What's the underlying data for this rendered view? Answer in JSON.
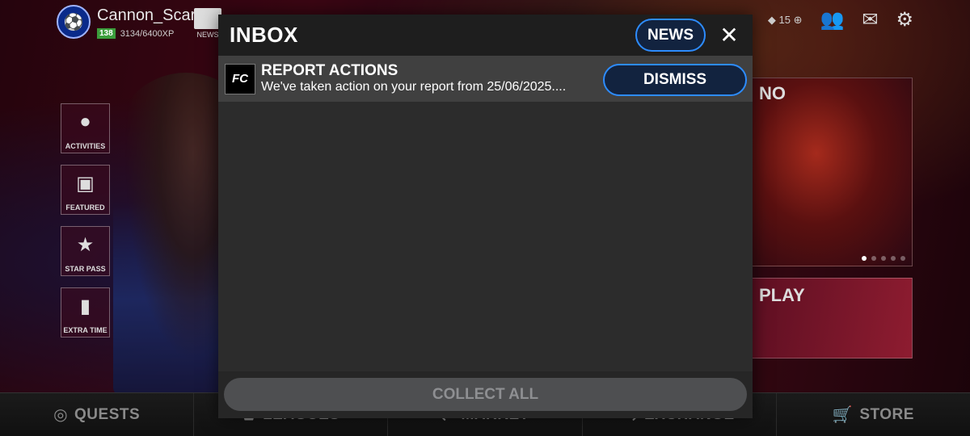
{
  "background": {
    "username": "Cannon_Scar",
    "level": "138",
    "xp": "3134/6400XP",
    "news_label": "NEWS",
    "coins": "15",
    "side_menu": [
      {
        "label": "ACTIVITIES",
        "icon": "ball-icon"
      },
      {
        "label": "FEATURED",
        "icon": "gift-icon"
      },
      {
        "label": "STAR PASS",
        "icon": "star-icon"
      },
      {
        "label": "EXTRA TIME",
        "icon": "card-icon"
      }
    ],
    "promo_title": "NO",
    "play_title": "PLAY",
    "bottom_nav": [
      {
        "label": "QUESTS",
        "icon": "target-icon"
      },
      {
        "label": "LEAGUES",
        "icon": "shield-icon"
      },
      {
        "label": "MARKET",
        "icon": "market-icon"
      },
      {
        "label": "EXCHANGE",
        "icon": "exchange-icon"
      },
      {
        "label": "STORE",
        "icon": "cart-icon"
      }
    ]
  },
  "inbox": {
    "title": "INBOX",
    "news_button": "NEWS",
    "close_glyph": "✕",
    "messages": [
      {
        "icon_text": "FC",
        "title": "REPORT ACTIONS",
        "body": "We've taken action on your report from 25/06/2025....",
        "action": "DISMISS"
      }
    ],
    "collect_all": "COLLECT ALL"
  },
  "colors": {
    "accent_blue": "#2d8cff",
    "modal_bg": "#2c2c2c",
    "header_bg": "#1e1e1e",
    "message_bg": "#404040",
    "disabled_button": "#4e4f51"
  }
}
